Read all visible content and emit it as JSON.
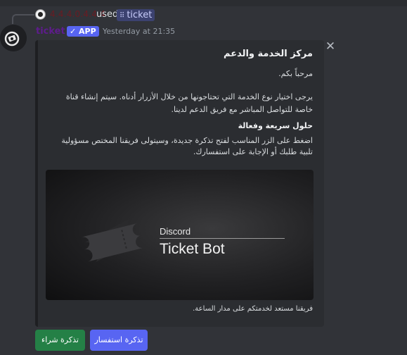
{
  "reply": {
    "user": "4.4.4.0.4.4.4",
    "used_text": "used",
    "command": "ticket"
  },
  "message": {
    "author": "ticket",
    "badge": "✓ APP",
    "timestamp": "Yesterday at 21:35"
  },
  "embed": {
    "title": "مركز الخدمة والدعم",
    "welcome": "مرحباً بكم.",
    "description": "يرجى اختيار نوع الخدمة التي تحتاجونها من خلال الأزرار أدناه. سيتم إنشاء قناة خاصة للتواصل المباشر مع فريق الدعم لدينا.",
    "field_name": "حلول سريعة وفعالة",
    "field_value": "اضغط على الزر المناسب لفتح تذكرة جديدة، وسيتولى فريقنا المختص مسؤولية تلبية طلبك أو الإجابة على استفسارك.",
    "banner_small": "Discord",
    "banner_big": "Ticket Bot",
    "footer": "فريقنا مستعد لخدمتكم على مدار الساعة."
  },
  "buttons": {
    "purchase": "تذكرة شراء",
    "inquiry": "تذكرة استفسار"
  },
  "colors": {
    "accent": "#5865f2",
    "success": "#248046",
    "background": "#313338",
    "embed": "#2b2d31"
  },
  "icons": [
    "close-icon",
    "slash-command-icon",
    "ticket-icon",
    "bot-avatar-icon"
  ]
}
